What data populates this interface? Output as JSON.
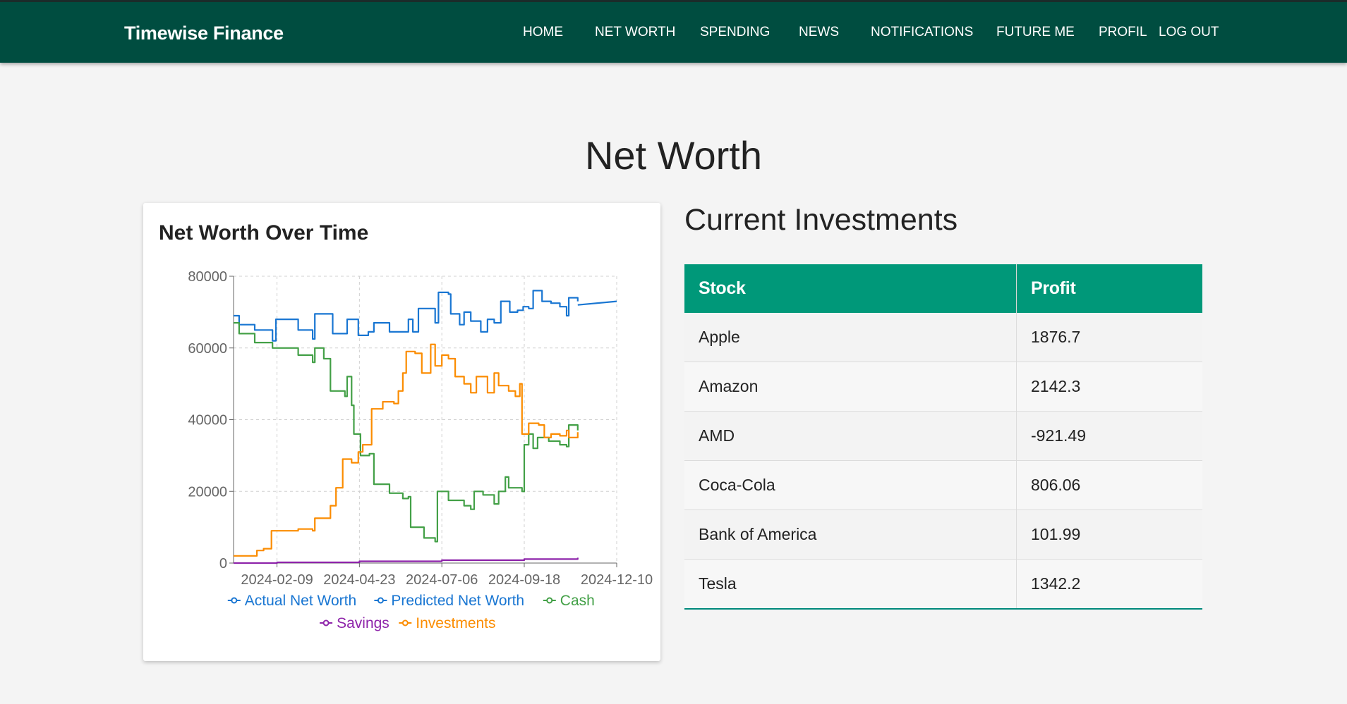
{
  "navbar": {
    "brand": "Timewise Finance",
    "links": [
      {
        "label": "HOME"
      },
      {
        "label": "NET WORTH"
      },
      {
        "label": "SPENDING"
      },
      {
        "label": "NEWS"
      },
      {
        "label": "NOTIFICATIONS"
      },
      {
        "label": "FUTURE ME"
      },
      {
        "label": "PROFIL"
      },
      {
        "label": "LOG OUT"
      }
    ]
  },
  "page": {
    "title": "Net Worth"
  },
  "chart_card": {
    "title": "Net Worth Over Time"
  },
  "investments": {
    "title": "Current Investments",
    "headers": [
      "Stock",
      "Profit"
    ],
    "rows": [
      {
        "stock": "Apple",
        "profit": "1876.7"
      },
      {
        "stock": "Amazon",
        "profit": "2142.3"
      },
      {
        "stock": "AMD",
        "profit": "-921.49"
      },
      {
        "stock": "Coca-Cola",
        "profit": "806.06"
      },
      {
        "stock": "Bank of America",
        "profit": "101.99"
      },
      {
        "stock": "Tesla",
        "profit": "1342.2"
      }
    ]
  },
  "colors": {
    "navbar": "#004d40",
    "table_header": "#009879",
    "actual": "#1976d2",
    "predicted": "#1976d2",
    "cash": "#43a047",
    "savings": "#8e24aa",
    "investments": "#fb8c00"
  },
  "chart_data": {
    "type": "line",
    "title": "Net Worth Over Time",
    "x_ticks": [
      "2024-02-09",
      "2024-04-23",
      "2024-07-06",
      "2024-09-18",
      "2024-12-10"
    ],
    "y_ticks": [
      0,
      20000,
      40000,
      60000,
      80000
    ],
    "xlim": [
      "2024-01-01",
      "2024-12-10"
    ],
    "ylim": [
      0,
      80000
    ],
    "grid": true,
    "legend": "bottom",
    "series": [
      {
        "name": "Actual Net Worth",
        "color": "#1976d2",
        "points": [
          [
            "2024-01-01",
            69000
          ],
          [
            "2024-01-06",
            66500
          ],
          [
            "2024-01-20",
            65000
          ],
          [
            "2024-02-05",
            62000
          ],
          [
            "2024-02-08",
            68000
          ],
          [
            "2024-02-28",
            65000
          ],
          [
            "2024-03-12",
            62500
          ],
          [
            "2024-03-14",
            69500
          ],
          [
            "2024-03-30",
            64000
          ],
          [
            "2024-04-12",
            68000
          ],
          [
            "2024-04-22",
            63500
          ],
          [
            "2024-05-01",
            64500
          ],
          [
            "2024-05-06",
            67000
          ],
          [
            "2024-05-20",
            64500
          ],
          [
            "2024-06-06",
            68000
          ],
          [
            "2024-06-10",
            64500
          ],
          [
            "2024-06-15",
            71000
          ],
          [
            "2024-06-30",
            67000
          ],
          [
            "2024-07-03",
            75500
          ],
          [
            "2024-07-12",
            75000
          ],
          [
            "2024-07-14",
            69500
          ],
          [
            "2024-07-22",
            66500
          ],
          [
            "2024-07-26",
            70000
          ],
          [
            "2024-08-01",
            67500
          ],
          [
            "2024-08-10",
            64500
          ],
          [
            "2024-08-16",
            68000
          ],
          [
            "2024-08-22",
            67000
          ],
          [
            "2024-08-28",
            73000
          ],
          [
            "2024-09-05",
            70000
          ],
          [
            "2024-09-12",
            70500
          ],
          [
            "2024-09-17",
            71500
          ],
          [
            "2024-09-22",
            71000
          ],
          [
            "2024-09-26",
            76000
          ],
          [
            "2024-10-04",
            73000
          ],
          [
            "2024-10-12",
            72500
          ],
          [
            "2024-10-20",
            71500
          ],
          [
            "2024-10-26",
            69000
          ],
          [
            "2024-10-28",
            74000
          ],
          [
            "2024-11-05",
            73000
          ]
        ]
      },
      {
        "name": "Predicted Net Worth",
        "color": "#1976d2",
        "points": [
          [
            "2024-11-05",
            72000
          ],
          [
            "2024-12-10",
            73000
          ]
        ]
      },
      {
        "name": "Cash",
        "color": "#43a047",
        "points": [
          [
            "2024-01-01",
            67000
          ],
          [
            "2024-01-06",
            64000
          ],
          [
            "2024-01-20",
            61500
          ],
          [
            "2024-02-05",
            60000
          ],
          [
            "2024-02-28",
            58000
          ],
          [
            "2024-03-12",
            56000
          ],
          [
            "2024-03-14",
            60000
          ],
          [
            "2024-03-22",
            57000
          ],
          [
            "2024-03-28",
            48000
          ],
          [
            "2024-04-10",
            46500
          ],
          [
            "2024-04-12",
            52000
          ],
          [
            "2024-04-16",
            44000
          ],
          [
            "2024-04-18",
            36000
          ],
          [
            "2024-04-24",
            30000
          ],
          [
            "2024-05-02",
            30500
          ],
          [
            "2024-05-06",
            22000
          ],
          [
            "2024-05-20",
            19500
          ],
          [
            "2024-06-01",
            18000
          ],
          [
            "2024-06-06",
            18500
          ],
          [
            "2024-06-08",
            10000
          ],
          [
            "2024-06-20",
            7000
          ],
          [
            "2024-06-30",
            6000
          ],
          [
            "2024-07-02",
            20000
          ],
          [
            "2024-07-12",
            17500
          ],
          [
            "2024-07-26",
            16000
          ],
          [
            "2024-08-01",
            15000
          ],
          [
            "2024-08-04",
            20000
          ],
          [
            "2024-08-12",
            19000
          ],
          [
            "2024-08-22",
            16500
          ],
          [
            "2024-08-26",
            20000
          ],
          [
            "2024-09-01",
            24000
          ],
          [
            "2024-09-04",
            21000
          ],
          [
            "2024-09-16",
            20000
          ],
          [
            "2024-09-18",
            33000
          ],
          [
            "2024-09-22",
            36000
          ],
          [
            "2024-09-26",
            32000
          ],
          [
            "2024-09-30",
            35000
          ],
          [
            "2024-10-10",
            34000
          ],
          [
            "2024-10-20",
            33000
          ],
          [
            "2024-10-26",
            32500
          ],
          [
            "2024-10-28",
            38500
          ],
          [
            "2024-11-05",
            37000
          ]
        ]
      },
      {
        "name": "Savings",
        "color": "#8e24aa",
        "points": [
          [
            "2024-01-01",
            0
          ],
          [
            "2024-02-09",
            200
          ],
          [
            "2024-04-23",
            500
          ],
          [
            "2024-07-06",
            800
          ],
          [
            "2024-09-18",
            1100
          ],
          [
            "2024-11-05",
            1500
          ]
        ]
      },
      {
        "name": "Investments",
        "color": "#fb8c00",
        "points": [
          [
            "2024-01-01",
            2000
          ],
          [
            "2024-01-20",
            2000
          ],
          [
            "2024-01-22",
            3500
          ],
          [
            "2024-01-28",
            4000
          ],
          [
            "2024-02-04",
            9000
          ],
          [
            "2024-02-28",
            9500
          ],
          [
            "2024-03-12",
            9000
          ],
          [
            "2024-03-14",
            12500
          ],
          [
            "2024-03-28",
            16000
          ],
          [
            "2024-04-02",
            21000
          ],
          [
            "2024-04-08",
            29000
          ],
          [
            "2024-04-16",
            28000
          ],
          [
            "2024-04-22",
            31000
          ],
          [
            "2024-04-26",
            33000
          ],
          [
            "2024-05-04",
            43000
          ],
          [
            "2024-05-14",
            45000
          ],
          [
            "2024-05-24",
            44500
          ],
          [
            "2024-05-28",
            48000
          ],
          [
            "2024-06-01",
            53000
          ],
          [
            "2024-06-04",
            59000
          ],
          [
            "2024-06-12",
            58500
          ],
          [
            "2024-06-18",
            53000
          ],
          [
            "2024-06-26",
            61000
          ],
          [
            "2024-06-30",
            55000
          ],
          [
            "2024-07-06",
            58000
          ],
          [
            "2024-07-12",
            57000
          ],
          [
            "2024-07-18",
            52000
          ],
          [
            "2024-07-26",
            50000
          ],
          [
            "2024-08-01",
            47500
          ],
          [
            "2024-08-06",
            52000
          ],
          [
            "2024-08-16",
            47500
          ],
          [
            "2024-08-22",
            53000
          ],
          [
            "2024-08-26",
            49500
          ],
          [
            "2024-09-04",
            48000
          ],
          [
            "2024-09-10",
            46500
          ],
          [
            "2024-09-14",
            50000
          ],
          [
            "2024-09-16",
            36000
          ],
          [
            "2024-09-22",
            39000
          ],
          [
            "2024-10-01",
            38500
          ],
          [
            "2024-10-06",
            35000
          ],
          [
            "2024-10-12",
            36000
          ],
          [
            "2024-10-20",
            35500
          ],
          [
            "2024-10-26",
            37000
          ],
          [
            "2024-10-28",
            35000
          ],
          [
            "2024-11-05",
            36500
          ]
        ]
      }
    ],
    "legend_entries": [
      {
        "name": "Actual Net Worth",
        "color": "#1976d2"
      },
      {
        "name": "Predicted Net Worth",
        "color": "#1976d2"
      },
      {
        "name": "Cash",
        "color": "#43a047"
      },
      {
        "name": "Savings",
        "color": "#8e24aa"
      },
      {
        "name": "Investments",
        "color": "#fb8c00"
      }
    ]
  }
}
